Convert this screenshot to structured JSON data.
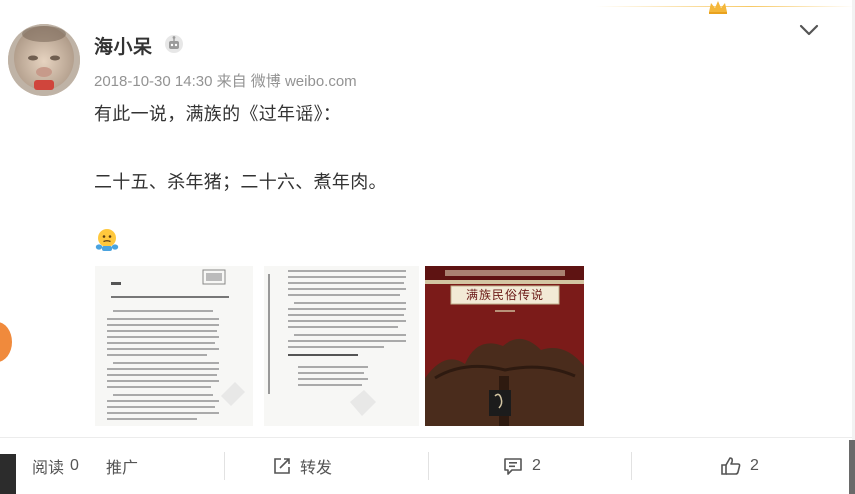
{
  "user": {
    "name": "海小呆"
  },
  "meta": {
    "timestamp": "2018-10-30 14:30",
    "from": "来自",
    "source": "微博 weibo.com"
  },
  "post": {
    "line1": "有此一说，满族的《过年谣》：",
    "line2": "二十五、杀年猪；二十六、煮年肉。"
  },
  "images": {
    "image3_title": "满族民俗传说"
  },
  "actions": {
    "read_label": "阅读",
    "read_count": "0",
    "promote_label": "推广",
    "repost_label": "转发",
    "comment_count": "2",
    "like_count": "2"
  },
  "icons": {
    "badge": "robot-badge-icon",
    "menu": "chevron-down-icon",
    "emoji": "thinking-face-icon",
    "repost": "share-icon",
    "comment": "comment-icon",
    "like": "thumbs-up-icon",
    "crown": "crown-icon"
  },
  "colors": {
    "text": "#333333",
    "meta": "#939393",
    "accent_gold": "#f7c966",
    "book_cover": "#7b1b19"
  }
}
